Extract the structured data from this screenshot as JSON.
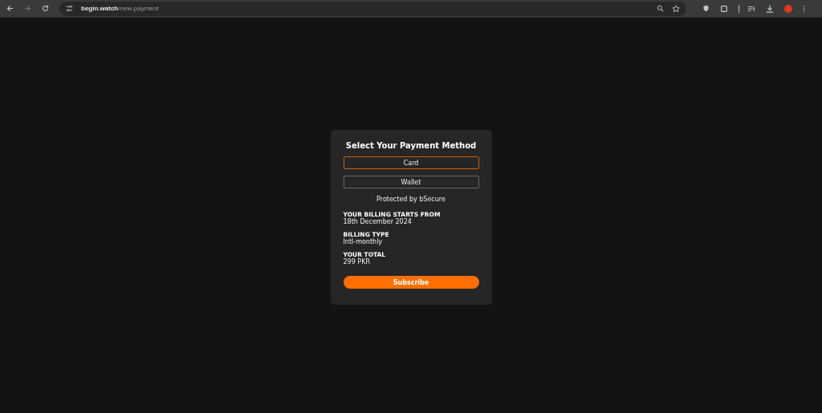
{
  "browser": {
    "url_host": "begin.watch",
    "url_path": "/new-payment"
  },
  "payment": {
    "title": "Select Your Payment Method",
    "methods": [
      {
        "label": "Card",
        "selected": true
      },
      {
        "label": "Wallet",
        "selected": false
      }
    ],
    "protected_note": "Protected by bSecure",
    "details": [
      {
        "label": "YOUR BILLING STARTS FROM",
        "value": "18th December 2024"
      },
      {
        "label": "BILLING TYPE",
        "value": "Intl-monthly"
      },
      {
        "label": "YOUR TOTAL",
        "value": "299 PKR"
      }
    ],
    "submit": "Subscribe"
  }
}
